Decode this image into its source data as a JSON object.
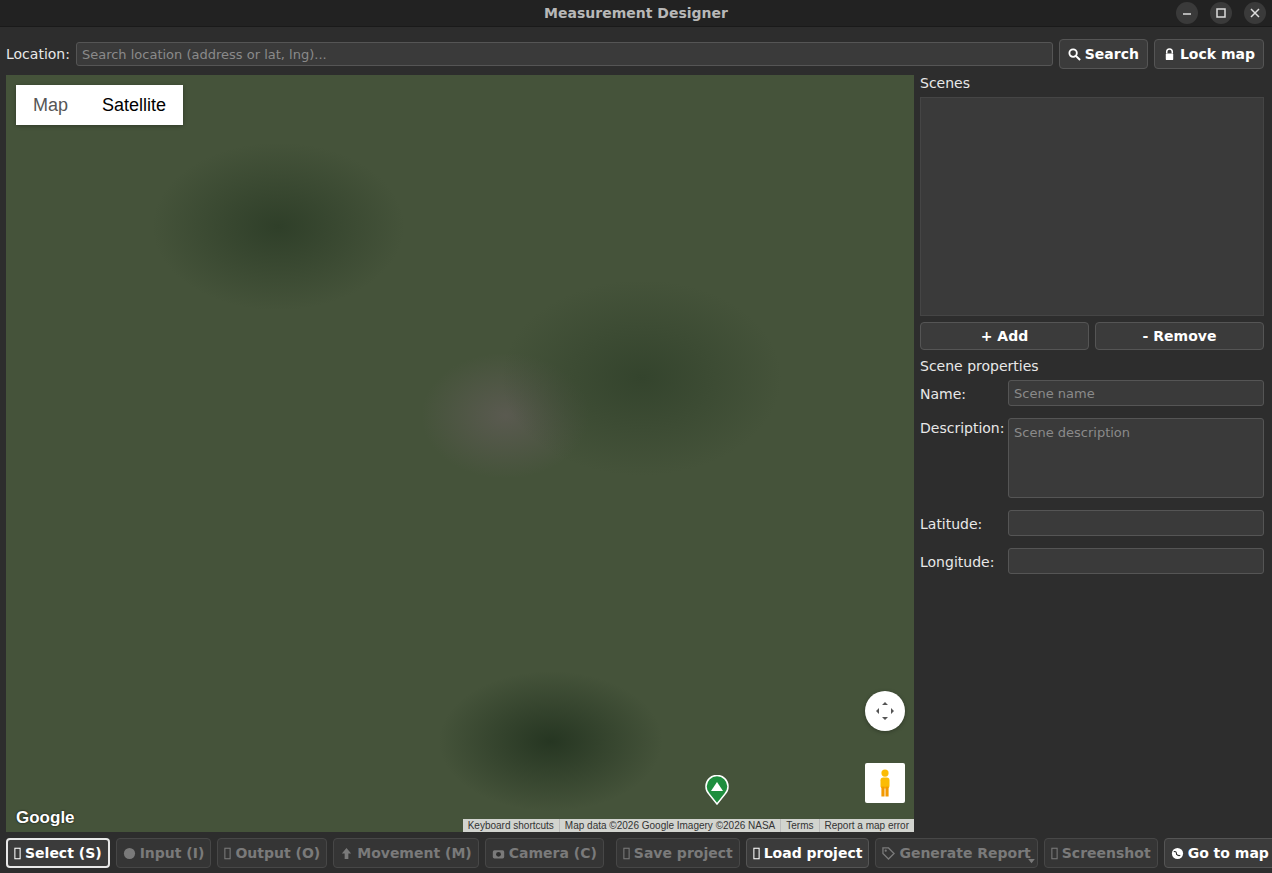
{
  "window": {
    "title": "Measurement Designer"
  },
  "location": {
    "label": "Location:",
    "placeholder": "Search location (address or lat, lng)..."
  },
  "top_buttons": [
    {
      "label": "Search"
    },
    {
      "label": "Lock map"
    }
  ],
  "map": {
    "types": [
      {
        "label": "Map",
        "selected": false
      },
      {
        "label": "Satellite",
        "selected": true
      }
    ],
    "logo": "Google",
    "attribution": [
      "Keyboard shortcuts",
      "Map data ©2026 Google Imagery ©2026 NASA",
      "Terms",
      "Report a map error"
    ]
  },
  "scenes": {
    "title": "Scenes",
    "items": [],
    "buttons": [
      "+ Add",
      "- Remove"
    ]
  },
  "properties": {
    "title": "Scene properties",
    "fields": [
      {
        "label": "Name:",
        "placeholder": "Scene name",
        "kind": "input"
      },
      {
        "label": "Description:",
        "placeholder": "Scene description",
        "kind": "textarea"
      },
      {
        "label": "Latitude:",
        "placeholder": "",
        "kind": "input"
      },
      {
        "label": "Longitude:",
        "placeholder": "",
        "kind": "input"
      }
    ]
  },
  "tools": [
    {
      "label": "Select (S)",
      "selected": true,
      "disabled": false
    },
    {
      "label": "Input (I)",
      "selected": false,
      "disabled": true
    },
    {
      "label": "Output (O)",
      "selected": false,
      "disabled": true
    },
    {
      "label": "Movement (M)",
      "selected": false,
      "disabled": true
    },
    {
      "label": "Camera (C)",
      "selected": false,
      "disabled": true
    }
  ],
  "actions": [
    {
      "label": "Save project",
      "disabled": true,
      "dropdown": false
    },
    {
      "label": "Load project",
      "disabled": false,
      "dropdown": false
    },
    {
      "label": "Generate Report",
      "disabled": true,
      "dropdown": true
    },
    {
      "label": "Screenshot",
      "disabled": true,
      "dropdown": false
    },
    {
      "label": "Go to map",
      "disabled": false,
      "dropdown": false
    }
  ]
}
